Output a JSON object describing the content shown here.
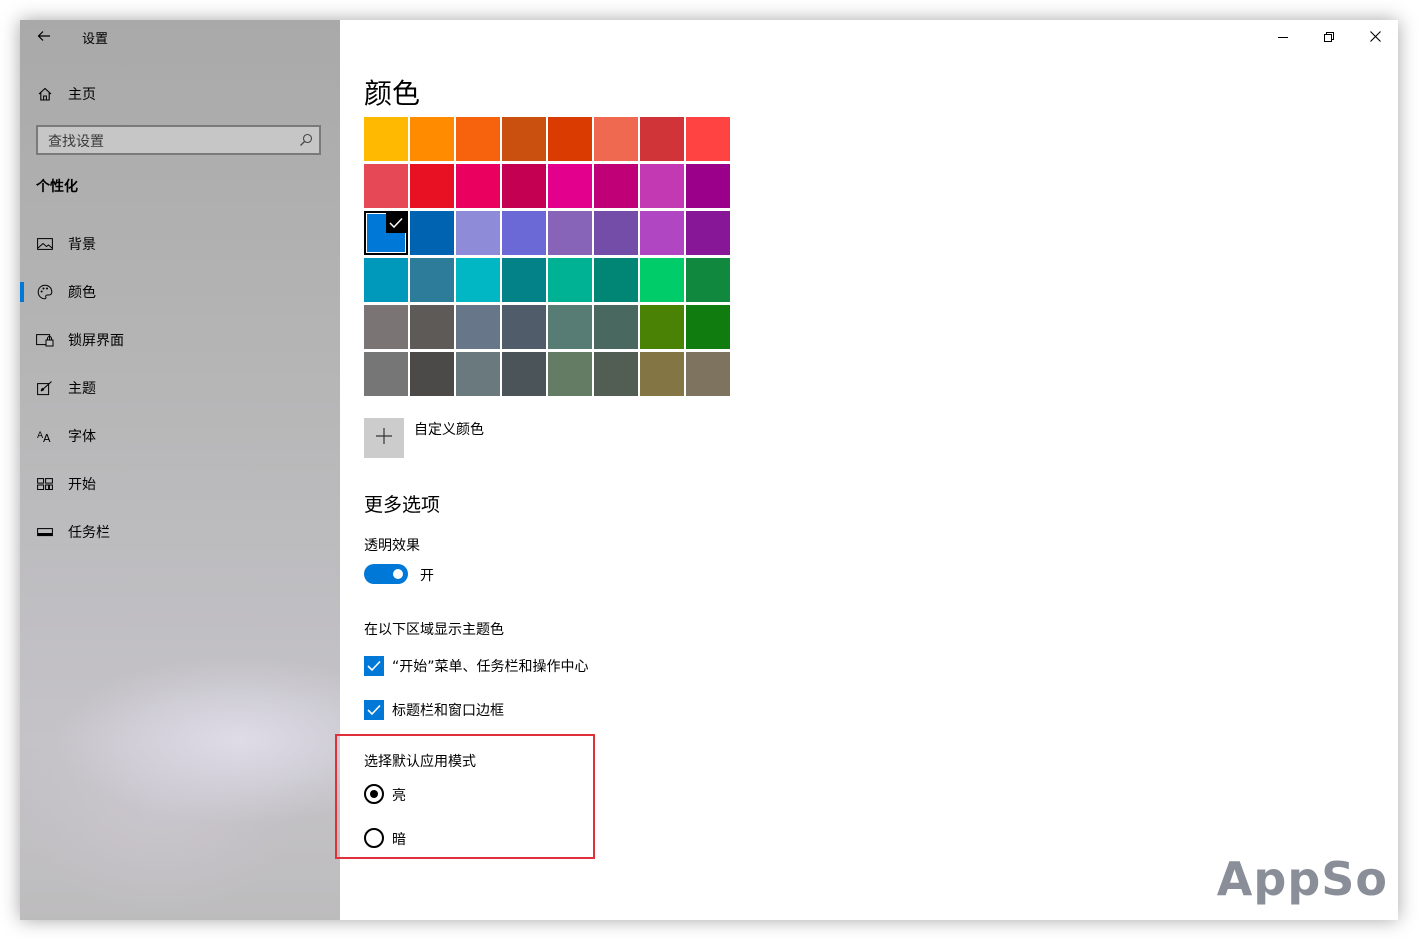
{
  "window": {
    "title": "设置",
    "buttons": [
      "minimize",
      "restore",
      "close"
    ]
  },
  "sidebar": {
    "home_label": "主页",
    "search_placeholder": "查找设置",
    "section_title": "个性化",
    "items": [
      {
        "label": "背景",
        "icon": "picture-icon",
        "active": false
      },
      {
        "label": "颜色",
        "icon": "palette-icon",
        "active": true
      },
      {
        "label": "锁屏界面",
        "icon": "lock-screen-icon",
        "active": false
      },
      {
        "label": "主题",
        "icon": "theme-brush-icon",
        "active": false
      },
      {
        "label": "字体",
        "icon": "font-icon",
        "active": false
      },
      {
        "label": "开始",
        "icon": "start-tiles-icon",
        "active": false
      },
      {
        "label": "任务栏",
        "icon": "taskbar-icon",
        "active": false
      }
    ]
  },
  "main": {
    "title": "颜色",
    "colors": [
      [
        "#ffb900",
        "#ff8c00",
        "#f7630c",
        "#ca5010",
        "#da3b01",
        "#ef6950",
        "#d13438",
        "#ff4343"
      ],
      [
        "#e74856",
        "#e81123",
        "#ea005e",
        "#c30052",
        "#e3008c",
        "#bf0077",
        "#c239b3",
        "#9a0089"
      ],
      [
        "#0078d7",
        "#0063b1",
        "#8e8cd8",
        "#6b69d6",
        "#8764b8",
        "#744da9",
        "#b146c2",
        "#881798"
      ],
      [
        "#0099bc",
        "#2d7d9a",
        "#00b7c3",
        "#038387",
        "#00b294",
        "#018574",
        "#00cc6a",
        "#10893e"
      ],
      [
        "#7a7574",
        "#5d5a58",
        "#68768a",
        "#515c6b",
        "#567c73",
        "#486860",
        "#498205",
        "#107c10"
      ],
      [
        "#767676",
        "#4c4a48",
        "#69797e",
        "#4a5459",
        "#647c64",
        "#525e54",
        "#847545",
        "#7e735f"
      ]
    ],
    "selected_color": "#0078d7",
    "custom_color_label": "自定义颜色",
    "more_options_title": "更多选项",
    "transparency": {
      "label": "透明效果",
      "state_label": "开",
      "on": true
    },
    "accent_surfaces": {
      "label": "在以下区域显示主题色",
      "options": [
        {
          "label": "“开始”菜单、任务栏和操作中心",
          "checked": true
        },
        {
          "label": "标题栏和窗口边框",
          "checked": true
        }
      ]
    },
    "app_mode": {
      "label": "选择默认应用模式",
      "options": [
        {
          "label": "亮",
          "selected": true
        },
        {
          "label": "暗",
          "selected": false
        }
      ]
    }
  },
  "watermark": "AppSo"
}
